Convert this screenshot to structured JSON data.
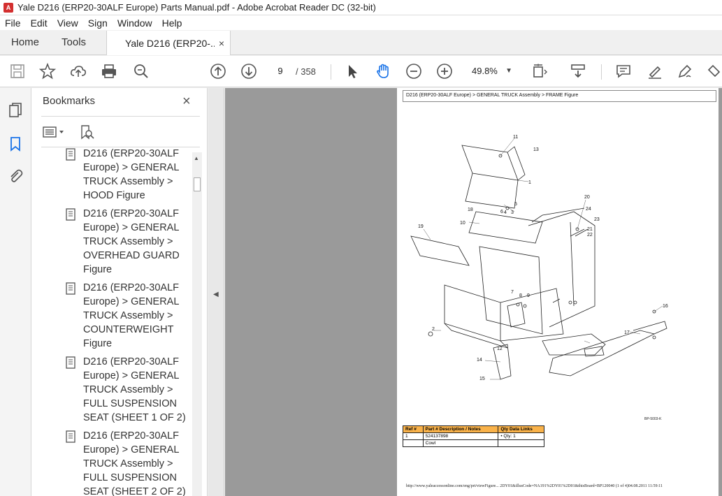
{
  "window": {
    "title": "Yale D216 (ERP20-30ALF Europe) Parts Manual.pdf - Adobe Acrobat Reader DC (32-bit)"
  },
  "menu": [
    "File",
    "Edit",
    "View",
    "Sign",
    "Window",
    "Help"
  ],
  "tabs": {
    "home": "Home",
    "tools": "Tools",
    "document": "Yale D216 (ERP20-...",
    "close": "×"
  },
  "toolbar": {
    "page_current": "9",
    "page_total": "/ 358",
    "zoom": "49.8%"
  },
  "bookmarks": {
    "header": "Bookmarks",
    "close": "×",
    "items": [
      {
        "text": "D216 (ERP20-30ALF Europe) > GENERAL TRUCK Assembly > HOOD Figure"
      },
      {
        "text": "D216 (ERP20-30ALF Europe) > GENERAL TRUCK Assembly > OVERHEAD GUARD Figure"
      },
      {
        "text": "D216 (ERP20-30ALF Europe) > GENERAL TRUCK Assembly > COUNTERWEIGHT Figure"
      },
      {
        "text": "D216 (ERP20-30ALF Europe) > GENERAL TRUCK Assembly > FULL SUSPENSION SEAT (SHEET 1 OF 2)"
      },
      {
        "text": "D216 (ERP20-30ALF Europe) > GENERAL TRUCK Assembly > FULL SUSPENSION SEAT (SHEET 2 OF 2)"
      }
    ]
  },
  "pdf": {
    "breadcrumb": "D216 (ERP20-30ALF Europe) > GENERAL TRUCK Assembly > FRAME Figure",
    "figure_code": "BP-5003-K",
    "table": {
      "headers": [
        "Ref #",
        "Part # Description / Notes",
        "Qty Data Links"
      ],
      "rows": [
        {
          "ref": "1",
          "part": "524137898",
          "qty": "• Qty: 1"
        },
        {
          "ref": "",
          "part": "Cowl",
          "qty": ""
        }
      ]
    },
    "footer": "http://www.yaleaccessonline.com/eng/prt/viewFigure... 2DY01&illusCode=NA191%2DY01%2D01&thisBoard=BP120040 (1 of 4)04.08.2011 11:59:11",
    "callouts": [
      "1",
      "2",
      "3",
      "4",
      "5",
      "6",
      "7",
      "8",
      "9",
      "10",
      "11",
      "12",
      "13",
      "14",
      "15",
      "16",
      "17",
      "18",
      "19",
      "20",
      "21",
      "22",
      "23",
      "24"
    ]
  }
}
